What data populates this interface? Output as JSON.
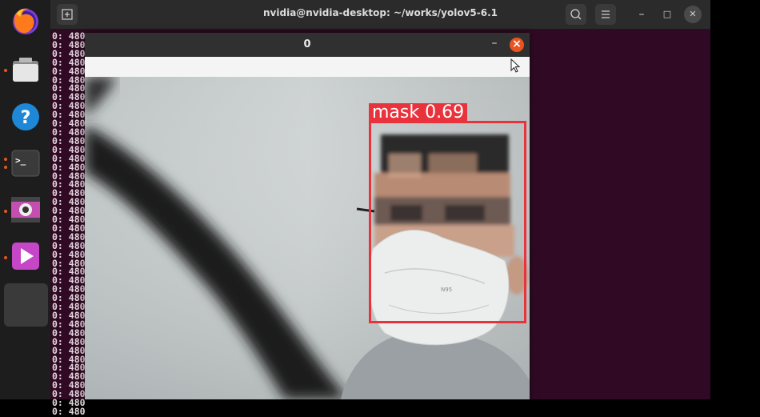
{
  "terminal": {
    "title": "nvidia@nvidia-desktop: ~/works/yolov5-6.1",
    "line_prefix": "0: 480",
    "line_count": 44,
    "buttons": {
      "new_tab_icon": "new-tab-icon",
      "search_icon": "search-icon",
      "menu_icon": "hamburger-menu-icon",
      "minimize": "–",
      "maximize": "□",
      "close": "✕"
    }
  },
  "image_window": {
    "title": "0",
    "minimize": "–",
    "close": "×"
  },
  "detection": {
    "label": "mask 0.69",
    "color": "#e8323c"
  },
  "dock": {
    "items": [
      {
        "name": "firefox",
        "running": false
      },
      {
        "name": "files",
        "running": true
      },
      {
        "name": "help",
        "running": false
      },
      {
        "name": "terminal",
        "running": true
      },
      {
        "name": "cheese-webcam",
        "running": true
      },
      {
        "name": "media-player",
        "running": true
      },
      {
        "name": "active-window",
        "running": true
      }
    ]
  },
  "colors": {
    "terminal_bg": "#300a24",
    "ubuntu_orange": "#e95420"
  }
}
